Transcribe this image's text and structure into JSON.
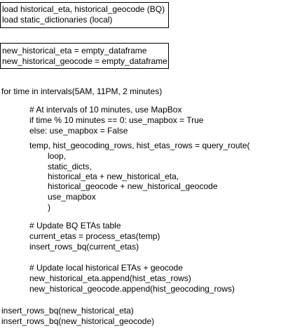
{
  "box_load": [
    "load historical_eta, historical_geocode (BQ)",
    "load static_dictionaries (local)"
  ],
  "box_new": [
    "new_historical_eta = empty_dataframe",
    "new_historical_geocode = empty_dataframe"
  ],
  "loop_header": "for time in intervals(5AM, 11PM, 2 minutes)",
  "mapbox_block": [
    "# At intervals of 10 minutes, use MapBox",
    "if time % 10 minutes == 0: use_mapbox = True",
    "else: use_mapbox = False"
  ],
  "query_call": "temp, hist_geocoding_rows, hist_etas_rows = query_route(",
  "query_args": [
    "loop,",
    "static_dicts,",
    "historical_eta + new_historical_eta,",
    "historical_geocode + new_historical_geocode",
    "use_mapbox",
    ")"
  ],
  "bq_block": [
    "# Update BQ ETAs table",
    "current_etas = process_etas(temp)",
    "insert_rows_bq(current_etas)"
  ],
  "local_block": [
    "# Update local historical ETAs + geocode",
    "new_historical_eta.append(hist_etas_rows)",
    "new_historical_geocode.append(hist_geocoding_rows)"
  ],
  "final_block": [
    "insert_rows_bq(new_historical_eta)",
    "insert_rows_bq(new_historical_geocode)"
  ]
}
